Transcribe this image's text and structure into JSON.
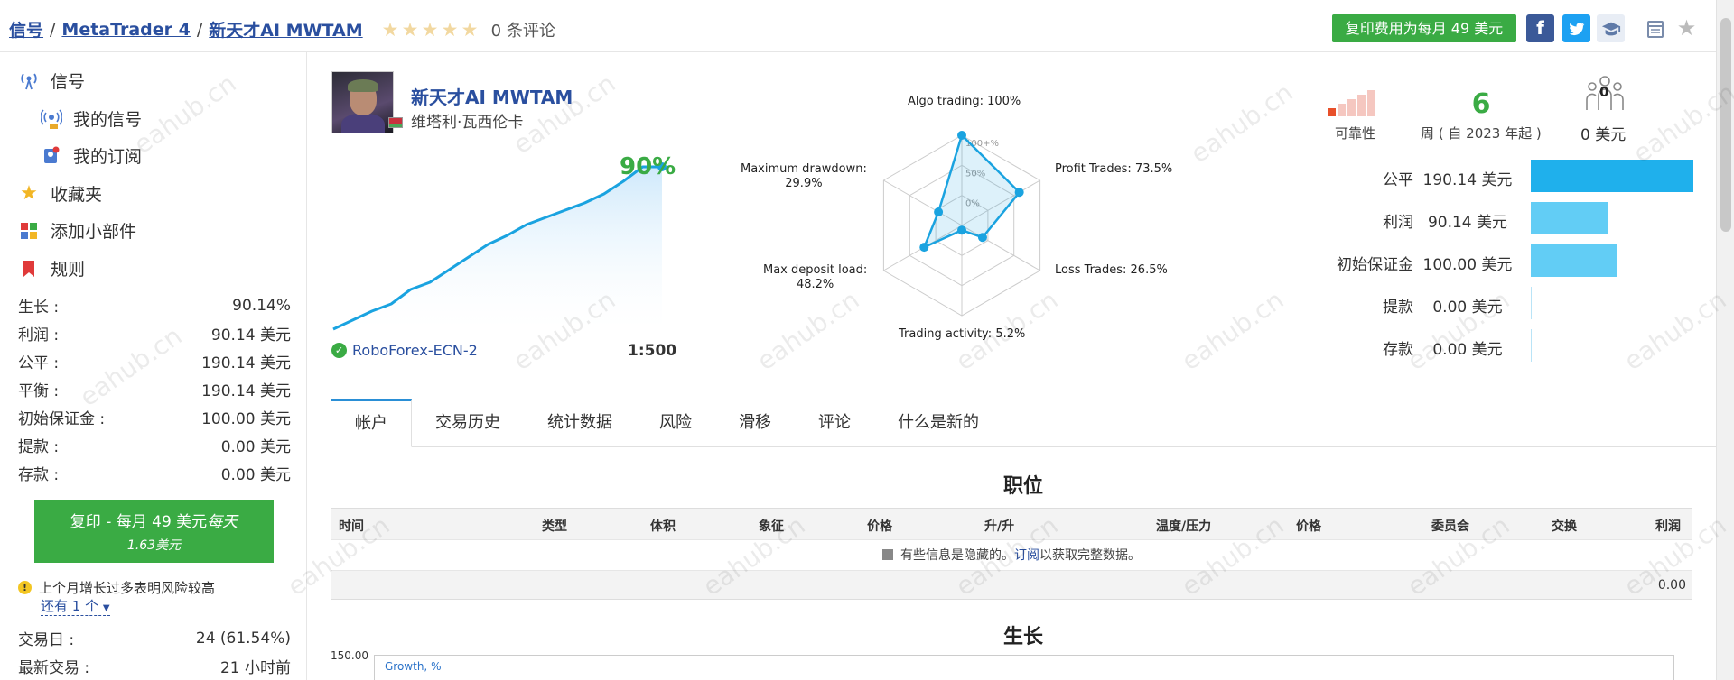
{
  "breadcrumb": {
    "items": [
      "信号",
      "MetaTrader 4",
      "新天才AI MWTAM"
    ],
    "separator": "/"
  },
  "rating": {
    "stars": 5,
    "filled": 0,
    "reviews_text": "0 条评论"
  },
  "header": {
    "copy_button": "复印费用为每月 49 美元",
    "social": {
      "facebook": "f",
      "twitter": "t"
    }
  },
  "sidebar": {
    "nav": [
      {
        "label": "信号",
        "icon": "antenna-icon"
      },
      {
        "label": "我的信号",
        "icon": "broadcast-icon"
      },
      {
        "label": "我的订阅",
        "icon": "subscription-icon"
      },
      {
        "label": "收藏夹",
        "icon": "star-icon"
      },
      {
        "label": "添加小部件",
        "icon": "widget-icon"
      },
      {
        "label": "规则",
        "icon": "bookmark-icon"
      }
    ],
    "stats": [
      {
        "label": "生长 :",
        "value": "90.14%"
      },
      {
        "label": "利润 :",
        "value": "90.14 美元"
      },
      {
        "label": "公平 :",
        "value": "190.14 美元"
      },
      {
        "label": "平衡 :",
        "value": "190.14 美元"
      },
      {
        "label": "初始保证金 :",
        "value": "100.00 美元"
      },
      {
        "label": "提款 :",
        "value": "0.00 美元"
      },
      {
        "label": "存款 :",
        "value": "0.00 美元"
      }
    ],
    "subscribe_button": {
      "line1_main": "复印 - 每月 49 美元",
      "line1_italic": "每天",
      "line2": "1.63美元"
    },
    "warning": "上个月增长过多表明风险较高",
    "more": "还有 1 个",
    "stats2": [
      {
        "label": "交易日 :",
        "value": "24 (61.54%)"
      },
      {
        "label": "最新交易 :",
        "value": "21 小时前"
      }
    ]
  },
  "signal": {
    "name": "新天才AI MWTAM",
    "owner": "维塔利·瓦西伦卡",
    "growth_pct": "90%",
    "broker": "RoboForex-ECN-2",
    "leverage": "1:500"
  },
  "growth_mini": {
    "points": [
      0,
      5,
      10,
      14,
      22,
      26,
      33,
      40,
      47,
      52,
      58,
      62,
      66,
      70,
      75,
      82,
      90,
      90
    ]
  },
  "radar": {
    "axes": [
      {
        "label": "Algo trading: 100%",
        "value": 100
      },
      {
        "label": "Profit Trades: 73.5%",
        "value": 73.5
      },
      {
        "label": "Loss Trades: 26.5%",
        "value": 26.5
      },
      {
        "label": "Trading activity: 5.2%",
        "value": 5.2
      },
      {
        "label": "Max deposit load:",
        "value2": "48.2%",
        "value": 48.2
      },
      {
        "label": "Maximum drawdown:",
        "value2": "29.9%",
        "value": 29.9
      }
    ],
    "ring_labels": [
      "100+%",
      "50%",
      "0%"
    ],
    "color": "#1aa3e0"
  },
  "metrics_top": {
    "reliability_label": "可靠性",
    "weeks_value": "6",
    "weeks_label": "周 ( 自 2023 年起 )",
    "subscribers_value": "0",
    "subscribers_label": "0 美元"
  },
  "metrics": [
    {
      "label": "公平",
      "value": "190.14 美元",
      "ratio": 1.0,
      "color": "#1fb0ec"
    },
    {
      "label": "利润",
      "value": "90.14 美元",
      "ratio": 0.474,
      "color": "#62cdf5"
    },
    {
      "label": "初始保证金",
      "value": "100.00 美元",
      "ratio": 0.526,
      "color": "#62cdf5"
    },
    {
      "label": "提款",
      "value": "0.00 美元",
      "ratio": 0,
      "color": "#62cdf5"
    },
    {
      "label": "存款",
      "value": "0.00 美元",
      "ratio": 0,
      "color": "#62cdf5"
    }
  ],
  "tabs": [
    "帐户",
    "交易历史",
    "统计数据",
    "风险",
    "滑移",
    "评论",
    "什么是新的"
  ],
  "positions": {
    "title": "职位",
    "columns": [
      "时间",
      "类型",
      "体积",
      "象征",
      "价格",
      "升/升",
      "温度/压力",
      "价格",
      "委员会",
      "交换",
      "利润"
    ],
    "info_prefix": "有些信息是隐藏的。",
    "info_link": "订阅",
    "info_suffix": "以获取完整数据。",
    "total": "0.00"
  },
  "growth": {
    "title": "生长",
    "y_top_label": "150.00",
    "legend": "Growth, %"
  },
  "watermark": "eahub.cn"
}
